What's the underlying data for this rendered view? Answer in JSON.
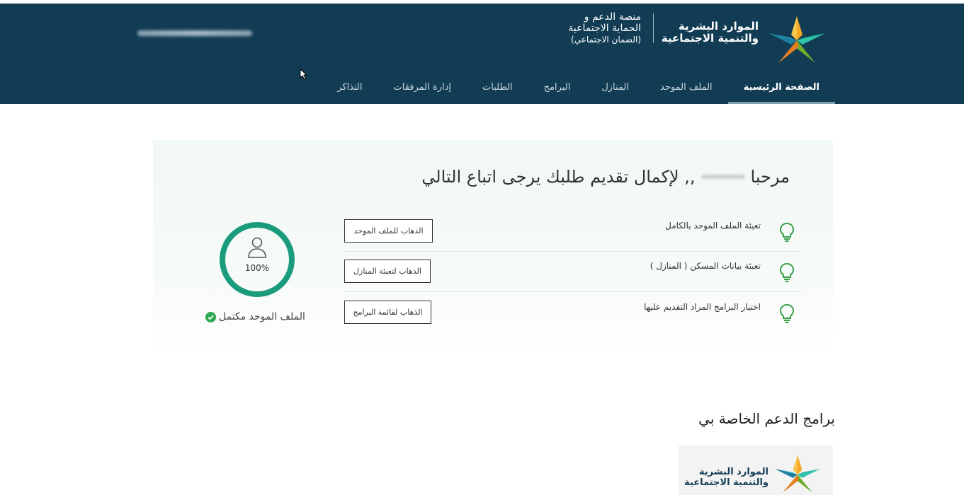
{
  "header": {
    "brand_line1": "الموارد البشرية",
    "brand_line2": "والتنمية الاجتماعية",
    "platform_line1": "منصة الدعم و",
    "platform_line2": "الحماية الاجتماعية",
    "platform_line3": "(الضمان الاجتماعي)"
  },
  "nav": {
    "items": [
      {
        "label": "الصفحة الرئيسية",
        "active": true
      },
      {
        "label": "الملف الموحد"
      },
      {
        "label": "المنازل"
      },
      {
        "label": "البرامج"
      },
      {
        "label": "الطلبات"
      },
      {
        "label": "إدارة المرفقات"
      },
      {
        "label": "التذاكر"
      }
    ]
  },
  "welcome": {
    "greeting": "مرحبا",
    "message": ",, لإكمال تقديم طلبك يرجى اتباع التالي"
  },
  "tasks": [
    {
      "text": "تعبئة الملف الموحد بالكامل",
      "button": "الذهاب للملف الموحد"
    },
    {
      "text": "تعبئة بيانات المسكن ( المنازل )",
      "button": "الذهاب لتعبئة المنازل"
    },
    {
      "text": "اختيار البرامج المراد التقديم عليها",
      "button": "الذهاب لقائمة البرامج"
    }
  ],
  "profile": {
    "progress_percent": 100,
    "progress_label": "100%",
    "status": "الملف الموحد مكتمل"
  },
  "programs": {
    "title": "برامج الدعم الخاصة بي",
    "card_line1": "الموارد البشرية",
    "card_line2": "والتنمية الاجتماعية"
  },
  "colors": {
    "header_bg": "#113c54",
    "accent_green": "#1a9b7b",
    "check_green": "#2ea84f"
  }
}
